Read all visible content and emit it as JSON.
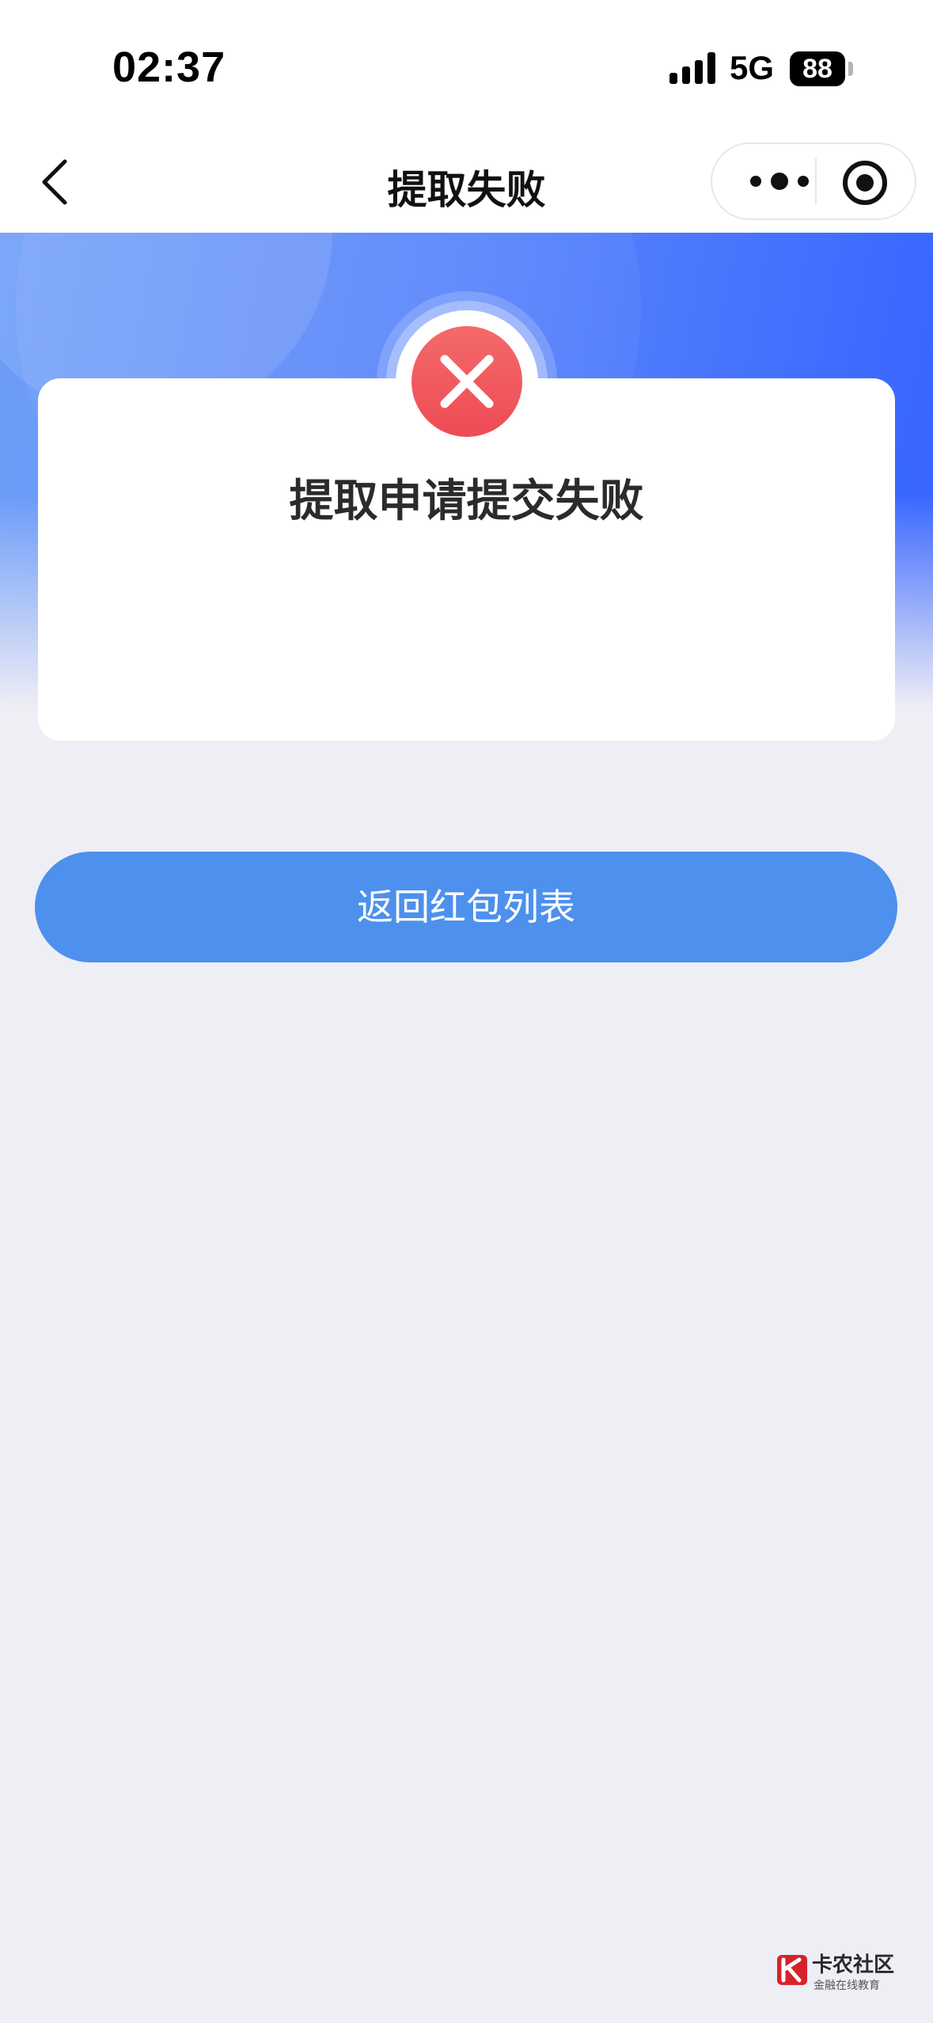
{
  "status_bar": {
    "time": "02:37",
    "network": "5G",
    "battery": "88"
  },
  "nav": {
    "title": "提取失败",
    "back_icon": "chevron-left-icon",
    "more_icon": "more-dots-icon",
    "close_icon": "target-icon"
  },
  "result": {
    "status_icon": "error-x-icon",
    "title": "提取申请提交失败"
  },
  "actions": {
    "return_label": "返回红包列表"
  },
  "watermark": {
    "name": "卡农社区",
    "tagline": "金融在线教育"
  },
  "colors": {
    "accent_blue": "#4d90ed",
    "header_blue": "#3563ff",
    "error_red": "#f25a5a",
    "background": "#eeeef5"
  }
}
